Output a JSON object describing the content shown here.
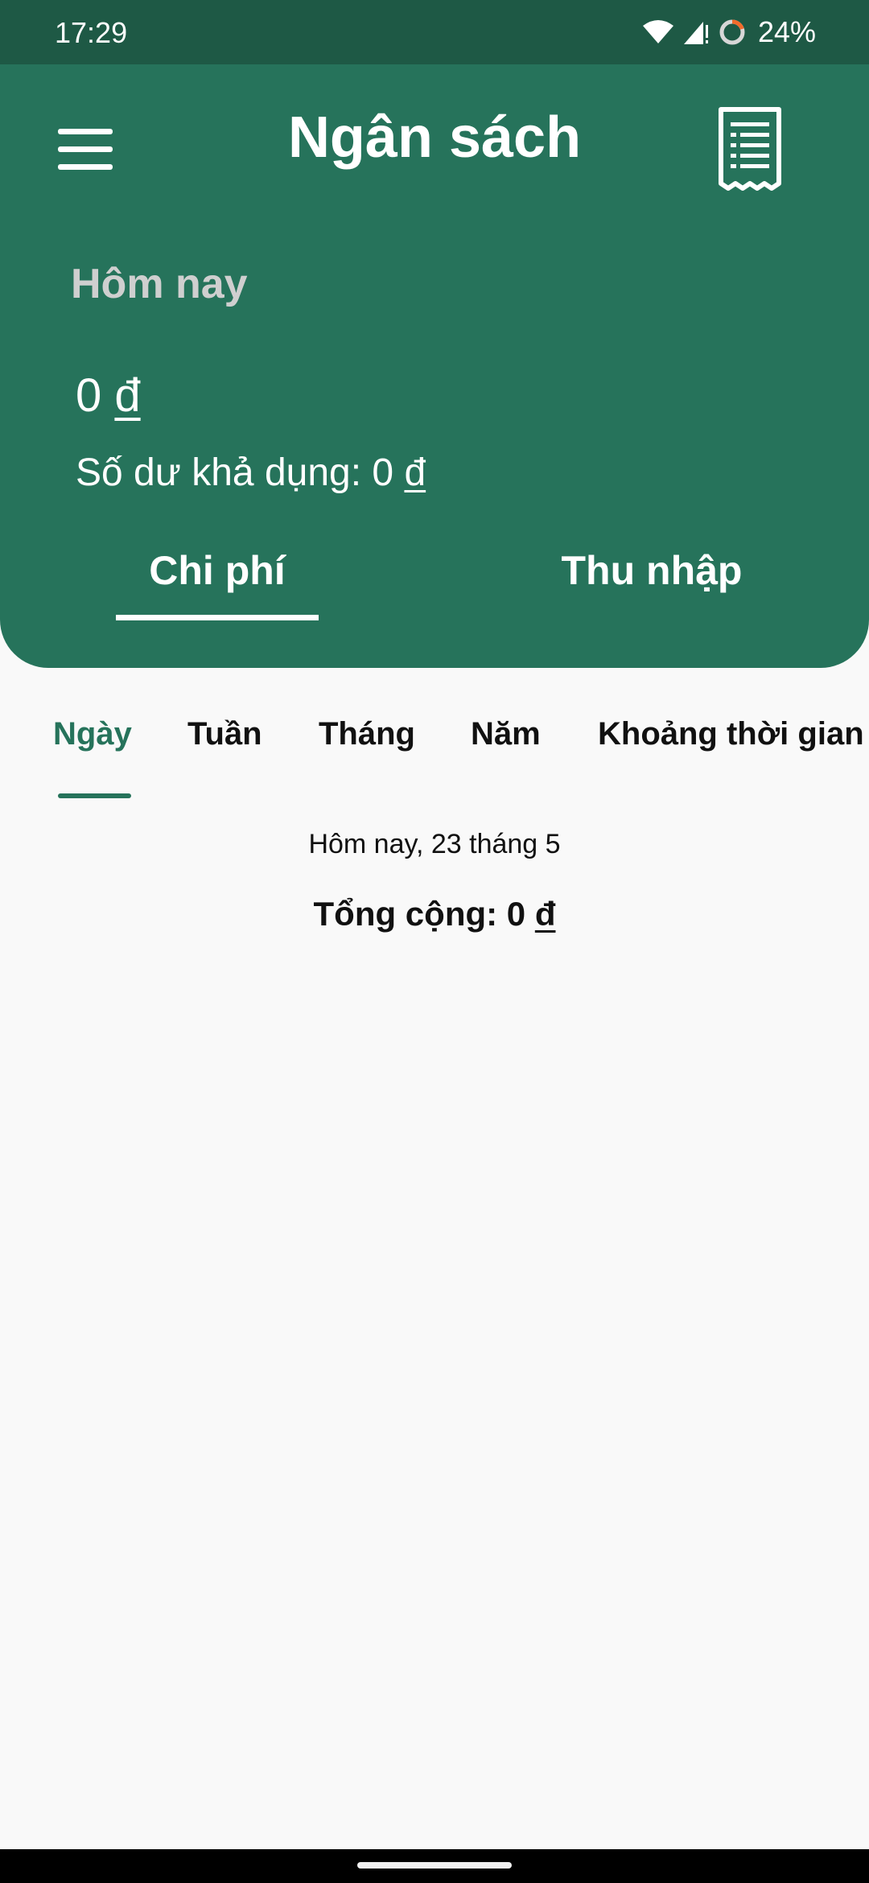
{
  "status_bar": {
    "time": "17:29",
    "battery": "24%",
    "icons": [
      "wifi-icon",
      "cell-signal-icon",
      "battery-saver-icon"
    ]
  },
  "header": {
    "title": "Ngân sách",
    "menu_icon": "hamburger-menu-icon",
    "receipt_icon": "receipt-icon",
    "period_label": "Hôm nay",
    "amount_value": "0",
    "currency": "đ",
    "balance_label": "Số dư khả dụng: 0",
    "tabs": [
      {
        "label": "Chi phí",
        "active": true
      },
      {
        "label": "Thu nhập",
        "active": false
      }
    ]
  },
  "period_tabs": [
    {
      "label": "Ngày",
      "active": true
    },
    {
      "label": "Tuần",
      "active": false
    },
    {
      "label": "Tháng",
      "active": false
    },
    {
      "label": "Năm",
      "active": false
    },
    {
      "label": "Khoảng thời gian",
      "active": false
    }
  ],
  "content": {
    "date": "Hôm nay, 23 tháng 5",
    "total_label": "Tổng cộng: 0"
  },
  "colors": {
    "primary": "#26735b",
    "status_bar": "#1e5945",
    "background": "#f9f9f9",
    "muted_label": "#cfcfcf"
  }
}
